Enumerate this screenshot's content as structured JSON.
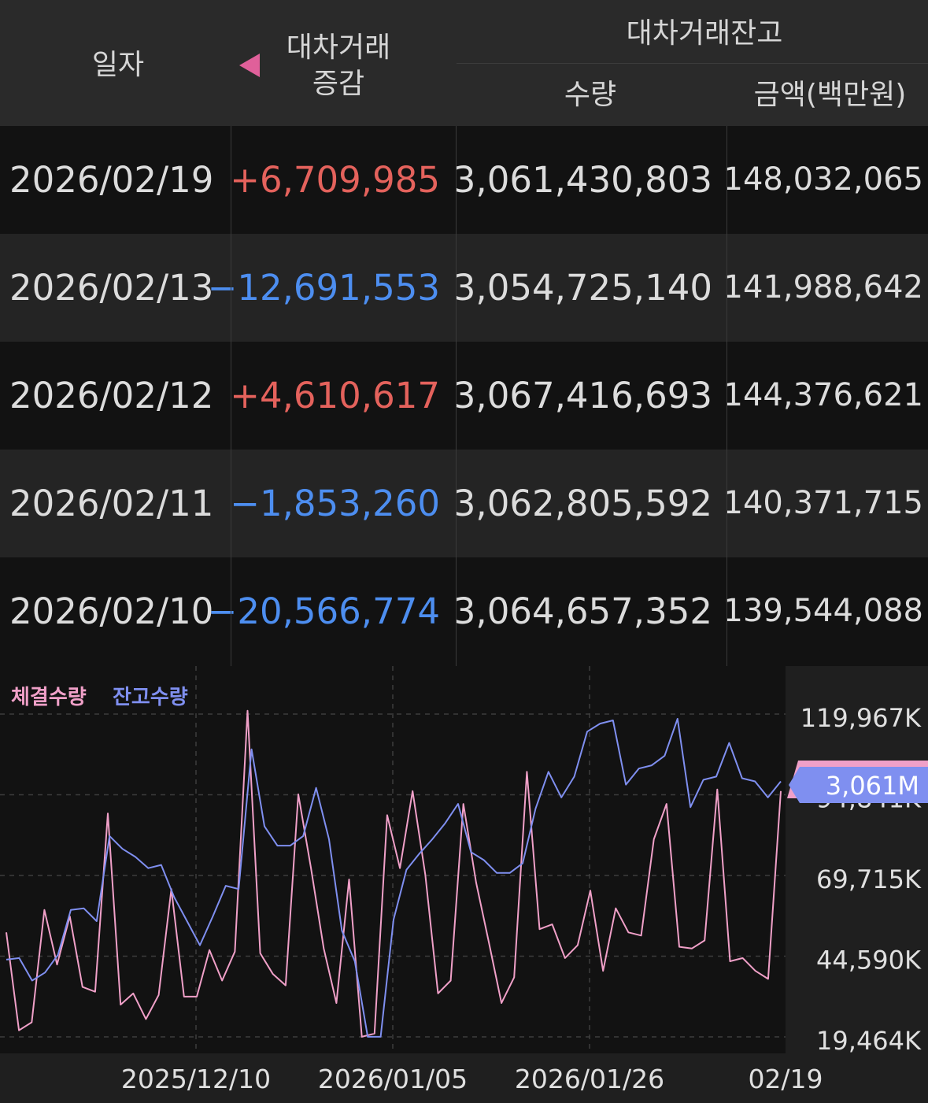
{
  "table": {
    "headers": {
      "date": "일자",
      "change_line1": "대차거래",
      "change_line2": "증감",
      "balance_group": "대차거래잔고",
      "quantity": "수량",
      "amount": "금액(백만원)"
    },
    "rows": [
      {
        "date": "2026/02/19",
        "change": "+6,709,985",
        "quantity": "3,061,430,803",
        "amount": "148,032,065"
      },
      {
        "date": "2026/02/13",
        "change": "−12,691,553",
        "quantity": "3,054,725,140",
        "amount": "141,988,642"
      },
      {
        "date": "2026/02/12",
        "change": "+4,610,617",
        "quantity": "3,067,416,693",
        "amount": "144,376,621"
      },
      {
        "date": "2026/02/11",
        "change": "−1,853,260",
        "quantity": "3,062,805,592",
        "amount": "140,371,715"
      },
      {
        "date": "2026/02/10",
        "change": "−20,566,774",
        "quantity": "3,064,657,352",
        "amount": "139,544,088"
      }
    ]
  },
  "chart_data": {
    "type": "line",
    "legend": [
      "체결수량",
      "잔고수량"
    ],
    "x_ticks": [
      "2025/12/10",
      "2026/01/05",
      "2026/01/26",
      "02/19"
    ],
    "y_ticks": [
      "119,967K",
      "94,841K",
      "69,715K",
      "44,590K",
      "19,464K"
    ],
    "ylim_K": [
      19464,
      119967
    ],
    "current_value_label": "3,061M",
    "series": [
      {
        "name": "체결수량",
        "values_K": [
          52000,
          21500,
          24000,
          59000,
          42000,
          57000,
          35000,
          33500,
          89000,
          29500,
          33000,
          25000,
          32500,
          65500,
          32000,
          32000,
          46500,
          37000,
          46000,
          121000,
          45500,
          39000,
          35500,
          95000,
          72000,
          47000,
          30000,
          68500,
          19500,
          20500,
          88500,
          72000,
          96000,
          70000,
          33000,
          37000,
          92000,
          67500,
          49000,
          30000,
          38000,
          102000,
          53000,
          54500,
          44000,
          48000,
          65000,
          40000,
          59500,
          52000,
          51000,
          81000,
          92000,
          47500,
          47000,
          49500,
          96500,
          43000,
          44000,
          40000,
          37500,
          96000
        ],
        "color": "#f0a0c8"
      },
      {
        "name": "잔고수량",
        "values_K": [
          43500,
          44000,
          37000,
          39500,
          45000,
          59000,
          59500,
          55500,
          82000,
          78000,
          75500,
          72000,
          73000,
          63000,
          55500,
          48000,
          57000,
          66500,
          65500,
          109000,
          85000,
          79000,
          79000,
          82000,
          97000,
          81000,
          52500,
          43000,
          19500,
          19500,
          56000,
          71500,
          76500,
          81000,
          86000,
          92000,
          77000,
          74500,
          70500,
          70500,
          73500,
          90500,
          102000,
          94000,
          100500,
          114500,
          117000,
          118000,
          98000,
          103000,
          104000,
          107000,
          118500,
          91000,
          99500,
          100500,
          111000,
          100000,
          99000,
          94000,
          99000
        ],
        "color": "#7f8ff0"
      }
    ]
  }
}
